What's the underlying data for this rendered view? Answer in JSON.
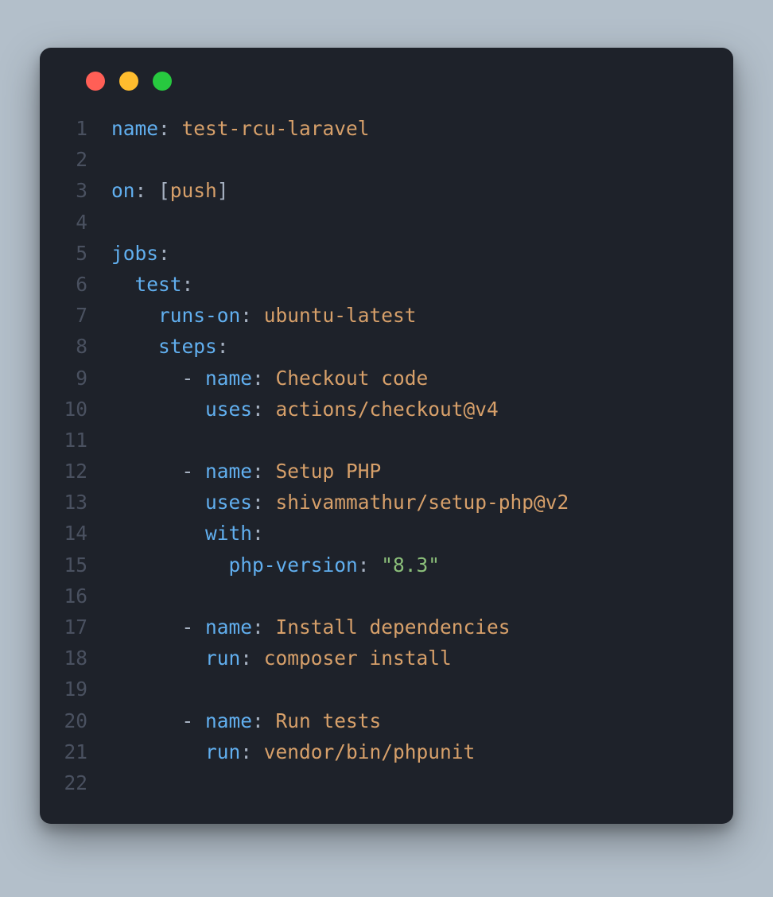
{
  "window": {
    "traffic_lights": [
      "red",
      "yellow",
      "green"
    ]
  },
  "colors": {
    "background_page": "#b3bfca",
    "background_window": "#1e222a",
    "gutter": "#4a5160",
    "key": "#61afef",
    "punct": "#a6b1c1",
    "value": "#d7a06a",
    "string": "#8bbf7a"
  },
  "code_lines": [
    {
      "num": 1,
      "tokens": [
        {
          "t": "name",
          "c": "key"
        },
        {
          "t": ": ",
          "c": "punct"
        },
        {
          "t": "test-rcu-laravel",
          "c": "val"
        }
      ]
    },
    {
      "num": 2,
      "tokens": []
    },
    {
      "num": 3,
      "tokens": [
        {
          "t": "on",
          "c": "key"
        },
        {
          "t": ": [",
          "c": "punct"
        },
        {
          "t": "push",
          "c": "val"
        },
        {
          "t": "]",
          "c": "punct"
        }
      ]
    },
    {
      "num": 4,
      "tokens": []
    },
    {
      "num": 5,
      "tokens": [
        {
          "t": "jobs",
          "c": "key"
        },
        {
          "t": ":",
          "c": "punct"
        }
      ]
    },
    {
      "num": 6,
      "tokens": [
        {
          "t": "  ",
          "c": "punct"
        },
        {
          "t": "test",
          "c": "key"
        },
        {
          "t": ":",
          "c": "punct"
        }
      ]
    },
    {
      "num": 7,
      "tokens": [
        {
          "t": "    ",
          "c": "punct"
        },
        {
          "t": "runs-on",
          "c": "key"
        },
        {
          "t": ": ",
          "c": "punct"
        },
        {
          "t": "ubuntu-latest",
          "c": "val"
        }
      ]
    },
    {
      "num": 8,
      "tokens": [
        {
          "t": "    ",
          "c": "punct"
        },
        {
          "t": "steps",
          "c": "key"
        },
        {
          "t": ":",
          "c": "punct"
        }
      ]
    },
    {
      "num": 9,
      "tokens": [
        {
          "t": "      - ",
          "c": "punct"
        },
        {
          "t": "name",
          "c": "key"
        },
        {
          "t": ": ",
          "c": "punct"
        },
        {
          "t": "Checkout code",
          "c": "val"
        }
      ]
    },
    {
      "num": 10,
      "tokens": [
        {
          "t": "        ",
          "c": "punct"
        },
        {
          "t": "uses",
          "c": "key"
        },
        {
          "t": ": ",
          "c": "punct"
        },
        {
          "t": "actions/checkout@v4",
          "c": "val"
        }
      ]
    },
    {
      "num": 11,
      "tokens": []
    },
    {
      "num": 12,
      "tokens": [
        {
          "t": "      - ",
          "c": "punct"
        },
        {
          "t": "name",
          "c": "key"
        },
        {
          "t": ": ",
          "c": "punct"
        },
        {
          "t": "Setup PHP",
          "c": "val"
        }
      ]
    },
    {
      "num": 13,
      "tokens": [
        {
          "t": "        ",
          "c": "punct"
        },
        {
          "t": "uses",
          "c": "key"
        },
        {
          "t": ": ",
          "c": "punct"
        },
        {
          "t": "shivammathur/setup-php@v2",
          "c": "val"
        }
      ]
    },
    {
      "num": 14,
      "tokens": [
        {
          "t": "        ",
          "c": "punct"
        },
        {
          "t": "with",
          "c": "key"
        },
        {
          "t": ":",
          "c": "punct"
        }
      ]
    },
    {
      "num": 15,
      "tokens": [
        {
          "t": "          ",
          "c": "punct"
        },
        {
          "t": "php-version",
          "c": "key"
        },
        {
          "t": ": ",
          "c": "punct"
        },
        {
          "t": "\"8.3\"",
          "c": "str"
        }
      ]
    },
    {
      "num": 16,
      "tokens": []
    },
    {
      "num": 17,
      "tokens": [
        {
          "t": "      - ",
          "c": "punct"
        },
        {
          "t": "name",
          "c": "key"
        },
        {
          "t": ": ",
          "c": "punct"
        },
        {
          "t": "Install dependencies",
          "c": "val"
        }
      ]
    },
    {
      "num": 18,
      "tokens": [
        {
          "t": "        ",
          "c": "punct"
        },
        {
          "t": "run",
          "c": "key"
        },
        {
          "t": ": ",
          "c": "punct"
        },
        {
          "t": "composer install",
          "c": "val"
        }
      ]
    },
    {
      "num": 19,
      "tokens": []
    },
    {
      "num": 20,
      "tokens": [
        {
          "t": "      - ",
          "c": "punct"
        },
        {
          "t": "name",
          "c": "key"
        },
        {
          "t": ": ",
          "c": "punct"
        },
        {
          "t": "Run tests",
          "c": "val"
        }
      ]
    },
    {
      "num": 21,
      "tokens": [
        {
          "t": "        ",
          "c": "punct"
        },
        {
          "t": "run",
          "c": "key"
        },
        {
          "t": ": ",
          "c": "punct"
        },
        {
          "t": "vendor/bin/phpunit",
          "c": "val"
        }
      ]
    },
    {
      "num": 22,
      "tokens": []
    }
  ]
}
